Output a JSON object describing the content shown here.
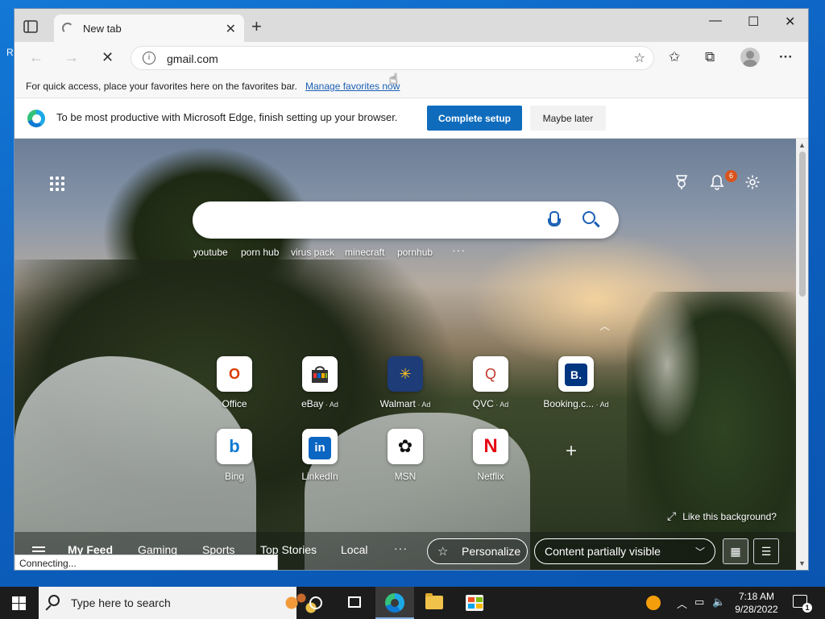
{
  "desktop": {
    "edge_char": "R"
  },
  "window": {
    "tab_title": "New tab",
    "tab_close": "✕",
    "new_tab": "+",
    "minimize": "—",
    "maximize": "☐",
    "close": "✕"
  },
  "address": {
    "back": "←",
    "forward": "→",
    "stop": "✕",
    "url": "gmail.com",
    "info": "i",
    "fav_star": "☆",
    "favorites": "✩",
    "collections": "⧉",
    "more": "···"
  },
  "favbar": {
    "message": "For quick access, place your favorites here on the favorites bar.",
    "link": "Manage favorites now"
  },
  "setup": {
    "message": "To be most productive with Microsoft Edge, finish setting up your browser.",
    "complete": "Complete setup",
    "later": "Maybe later"
  },
  "newtab": {
    "notifications_count": "6",
    "quick_links": [
      "youtube",
      "porn hub",
      "virus pack",
      "minecraft",
      "pornhub"
    ],
    "quick_more": "···",
    "chevron": "︿",
    "add_tile": "+",
    "like_background": "Like this background?",
    "expand": "⤢",
    "tiles": [
      {
        "label": "Office",
        "ad": "",
        "icon": "office-icon",
        "glyph": "O",
        "color": "#d83b01"
      },
      {
        "label": "eBay",
        "ad": " · Ad",
        "icon": "ebay-icon",
        "glyph": "🛍",
        "color": "#333333"
      },
      {
        "label": "Walmart",
        "ad": " · Ad",
        "icon": "walmart-icon",
        "glyph": "✳",
        "color": "#ffc220"
      },
      {
        "label": "QVC",
        "ad": " · Ad",
        "icon": "qvc-icon",
        "glyph": "Q",
        "color": "#c0392b"
      },
      {
        "label": "Booking.c...",
        "ad": " · Ad",
        "icon": "booking-icon",
        "glyph": "B.",
        "color": "#ffffff"
      },
      {
        "label": "Bing",
        "ad": "",
        "icon": "bing-icon",
        "glyph": "b",
        "color": "#0f7ad3"
      },
      {
        "label": "LinkedIn",
        "ad": "",
        "icon": "linkedin-icon",
        "glyph": "in",
        "color": "#ffffff"
      },
      {
        "label": "MSN",
        "ad": "",
        "icon": "msn-icon",
        "glyph": "✿",
        "color": "#111111"
      },
      {
        "label": "Netflix",
        "ad": "",
        "icon": "netflix-icon",
        "glyph": "N",
        "color": "#e50914"
      }
    ],
    "feed_tabs": [
      "My Feed",
      "Gaming",
      "Sports",
      "Top Stories",
      "Local"
    ],
    "feed_more": "···",
    "personalize": "Personalize",
    "content_visibility": "Content partially visible",
    "grid_view": "▦",
    "list_view": "☰"
  },
  "status": "Connecting...",
  "taskbar": {
    "search_placeholder": "Type here to search",
    "time": "7:18 AM",
    "date": "9/28/2022",
    "notification_count": "1"
  }
}
